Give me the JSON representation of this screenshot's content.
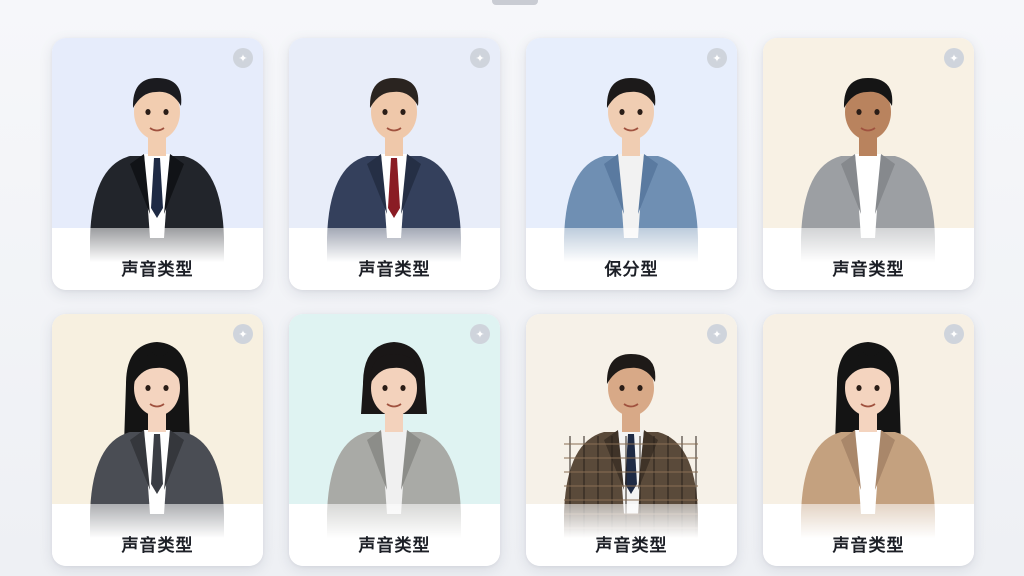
{
  "cards": [
    {
      "label": "声音类型",
      "bg": "#e6ecfb",
      "icon": "voice-icon",
      "skin": "#f2cdb0",
      "hair": "#1b1b1f",
      "outfit": "suit-black",
      "shirt": "#ffffff",
      "tie": "#1e2a44",
      "hairstyle": "short"
    },
    {
      "label": "声音类型",
      "bg": "#e8edf9",
      "icon": "voice-icon",
      "skin": "#efc8aa",
      "hair": "#2a2420",
      "outfit": "suit-navy",
      "shirt": "#ffffff",
      "tie": "#8a1c24",
      "hairstyle": "short"
    },
    {
      "label": "保分型",
      "bg": "#e7eefc",
      "icon": "voice-icon",
      "skin": "#f0cdb2",
      "hair": "#1c1a1a",
      "outfit": "denim",
      "shirt": "#f2f2f2",
      "tie": "",
      "hairstyle": "short"
    },
    {
      "label": "声音类型",
      "bg": "#f8f1e4",
      "icon": "voice-icon",
      "skin": "#b9835e",
      "hair": "#151515",
      "outfit": "hoodie-gray",
      "shirt": "#ffffff",
      "tie": "",
      "hairstyle": "short"
    },
    {
      "label": "声音类型",
      "bg": "#f7f0e0",
      "icon": "voice-icon",
      "skin": "#f4d4bf",
      "hair": "#141414",
      "outfit": "suit-gray",
      "shirt": "#ffffff",
      "tie": "#3a3d44",
      "hairstyle": "ponytail"
    },
    {
      "label": "声音类型",
      "bg": "#dff3f2",
      "icon": "voice-icon",
      "skin": "#f3d2bc",
      "hair": "#1a1717",
      "outfit": "cardigan",
      "shirt": "#f0f0f0",
      "tie": "",
      "hairstyle": "bob"
    },
    {
      "label": "声音类型",
      "bg": "#f6f1e8",
      "icon": "voice-icon",
      "skin": "#d8a987",
      "hair": "#1e1a18",
      "outfit": "plaid",
      "shirt": "#f4f4f4",
      "tie": "#1e2a44",
      "hairstyle": "short"
    },
    {
      "label": "声音类型",
      "bg": "#f7f0e4",
      "icon": "voice-icon",
      "skin": "#f4d4bf",
      "hair": "#141414",
      "outfit": "hoodie-tan",
      "shirt": "#ffffff",
      "tie": "",
      "hairstyle": "ponytail"
    }
  ]
}
